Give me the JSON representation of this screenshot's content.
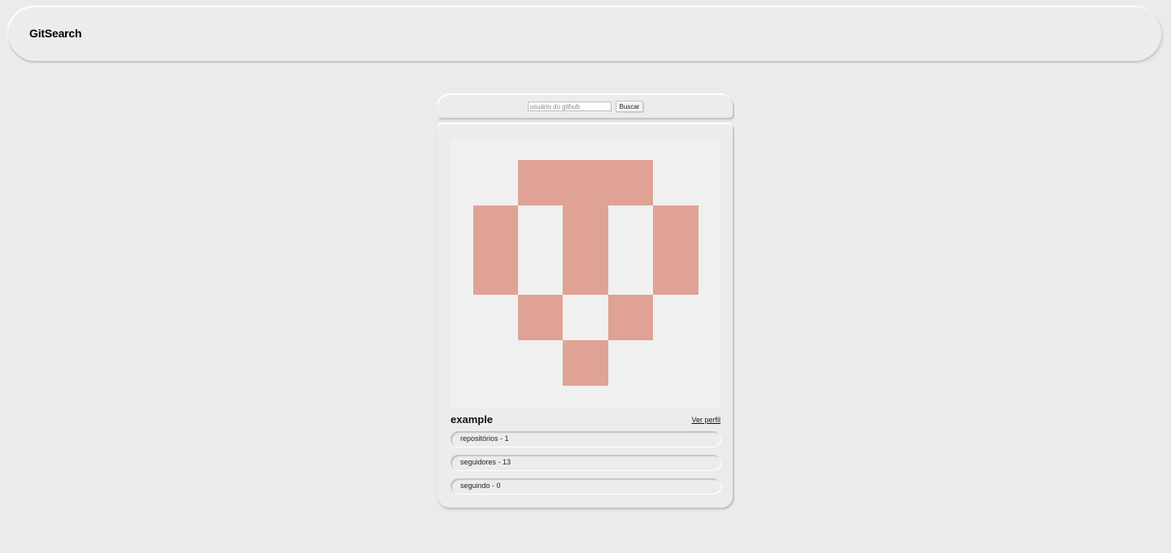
{
  "header": {
    "brand": "GitSearch"
  },
  "search": {
    "placeholder": "usuário do github",
    "value": "",
    "button_label": "Buscar"
  },
  "profile": {
    "username": "example",
    "profile_link_label": "Ver perfil",
    "avatar_color": "#e0a294",
    "avatar_background": "#f0f0f0",
    "stats": [
      {
        "label": "repositórios - 1"
      },
      {
        "label": "seguidores - 13"
      },
      {
        "label": "seguindo - 0"
      }
    ]
  }
}
